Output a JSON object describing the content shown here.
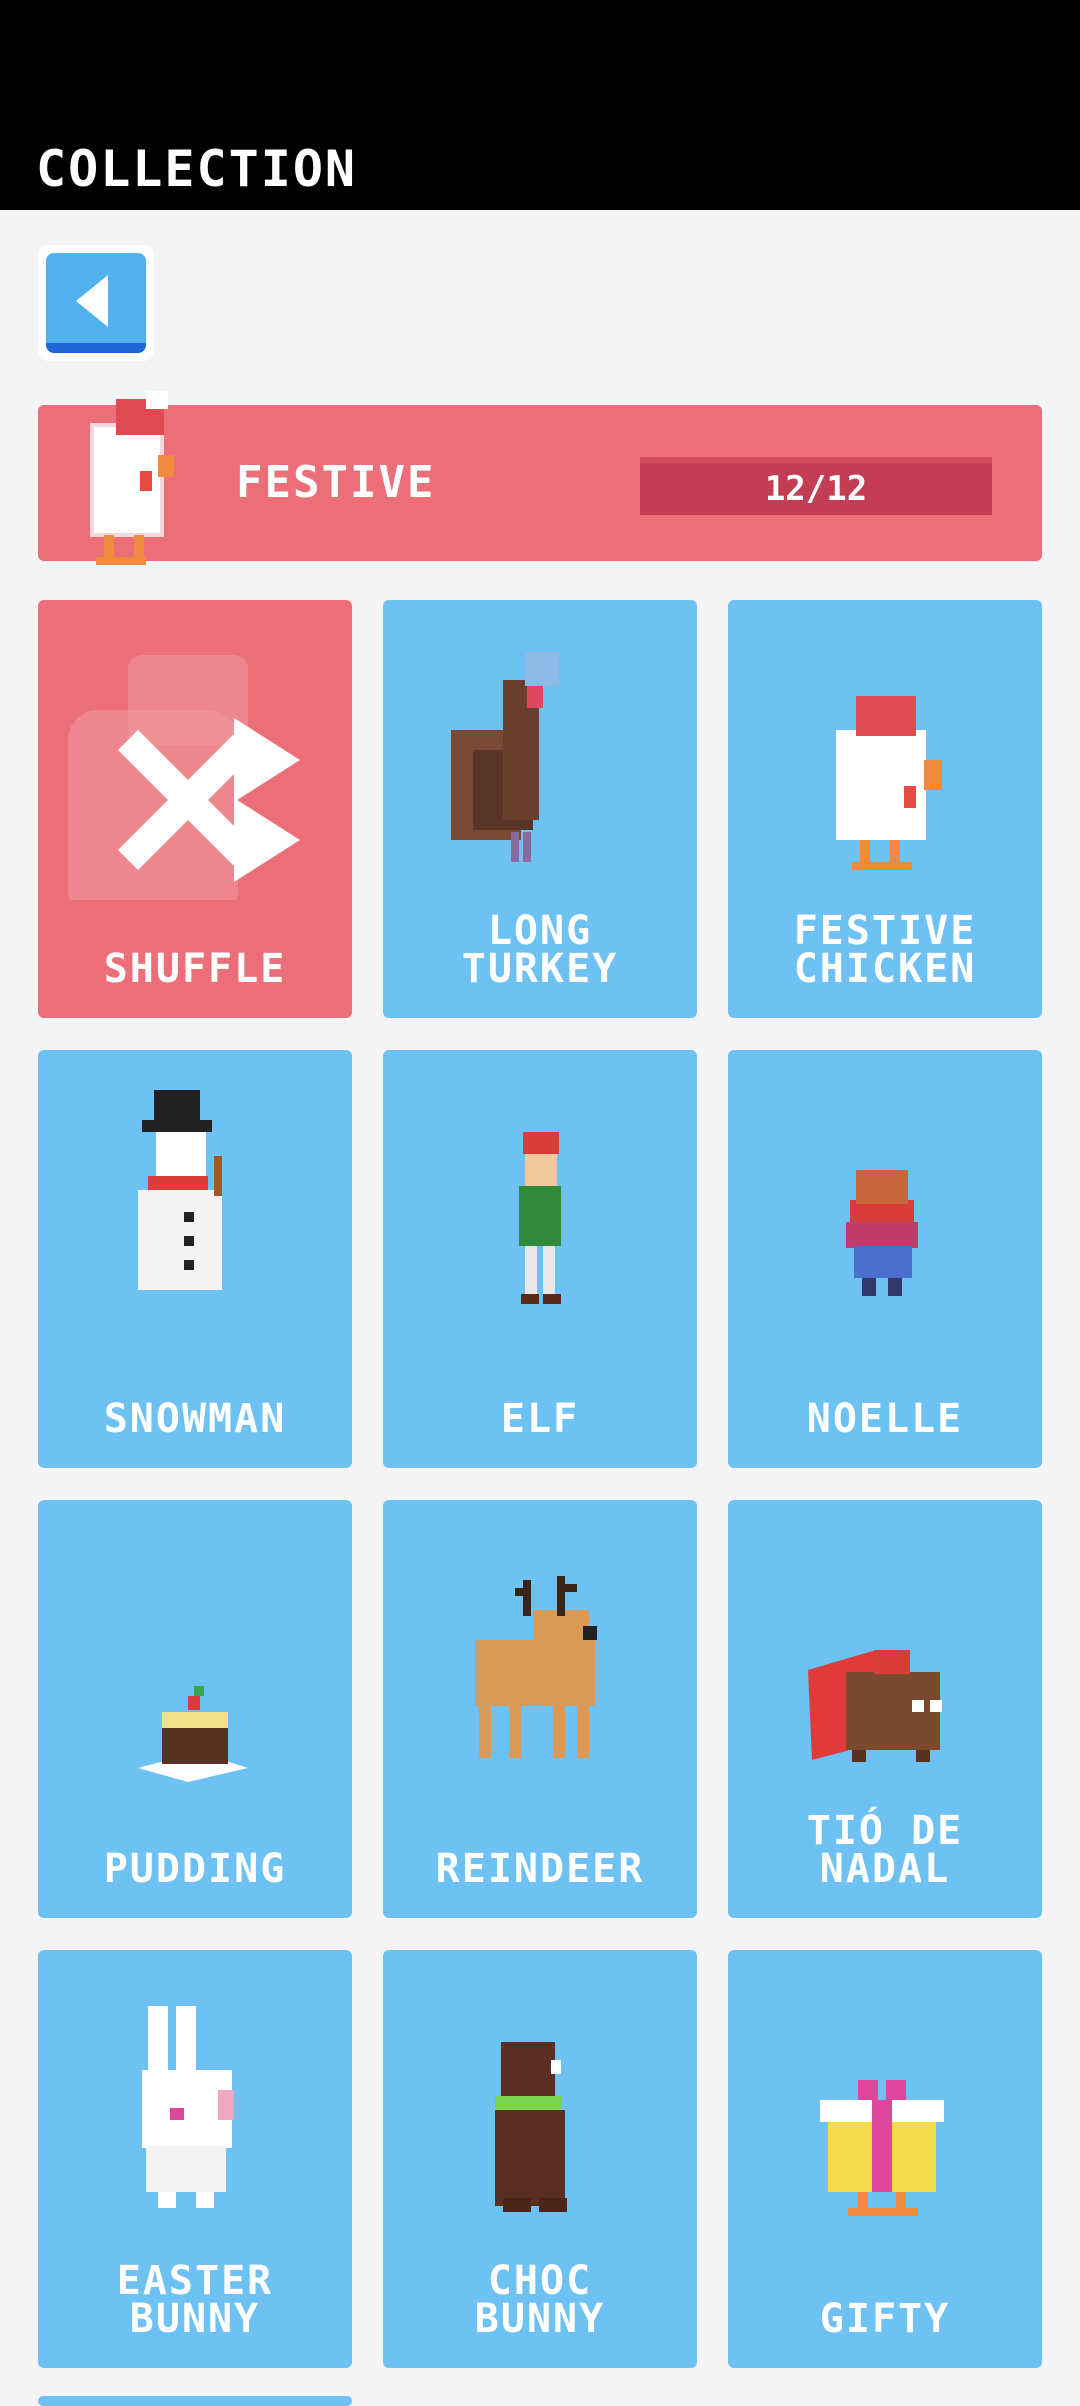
{
  "header": {
    "title": "COLLECTION"
  },
  "back_button": {
    "icon": "back-arrow-icon"
  },
  "banner": {
    "title": "FESTIVE",
    "progress_text": "12/12",
    "progress": 1.0
  },
  "characters": [
    {
      "label": "SHUFFLE"
    },
    {
      "label": "LONG\nTURKEY"
    },
    {
      "label": "FESTIVE\nCHICKEN"
    },
    {
      "label": "SNOWMAN"
    },
    {
      "label": "ELF"
    },
    {
      "label": "NOELLE"
    },
    {
      "label": "PUDDING"
    },
    {
      "label": "REINDEER"
    },
    {
      "label": "TIÓ DE\nNADAL"
    },
    {
      "label": "EASTER\nBUNNY"
    },
    {
      "label": "CHOC\nBUNNY"
    },
    {
      "label": "GIFTY"
    }
  ],
  "colors": {
    "card": "#6ec1f3",
    "shuffle_card": "#ec6e78",
    "banner": "#ec6e78",
    "header": "#000000"
  }
}
